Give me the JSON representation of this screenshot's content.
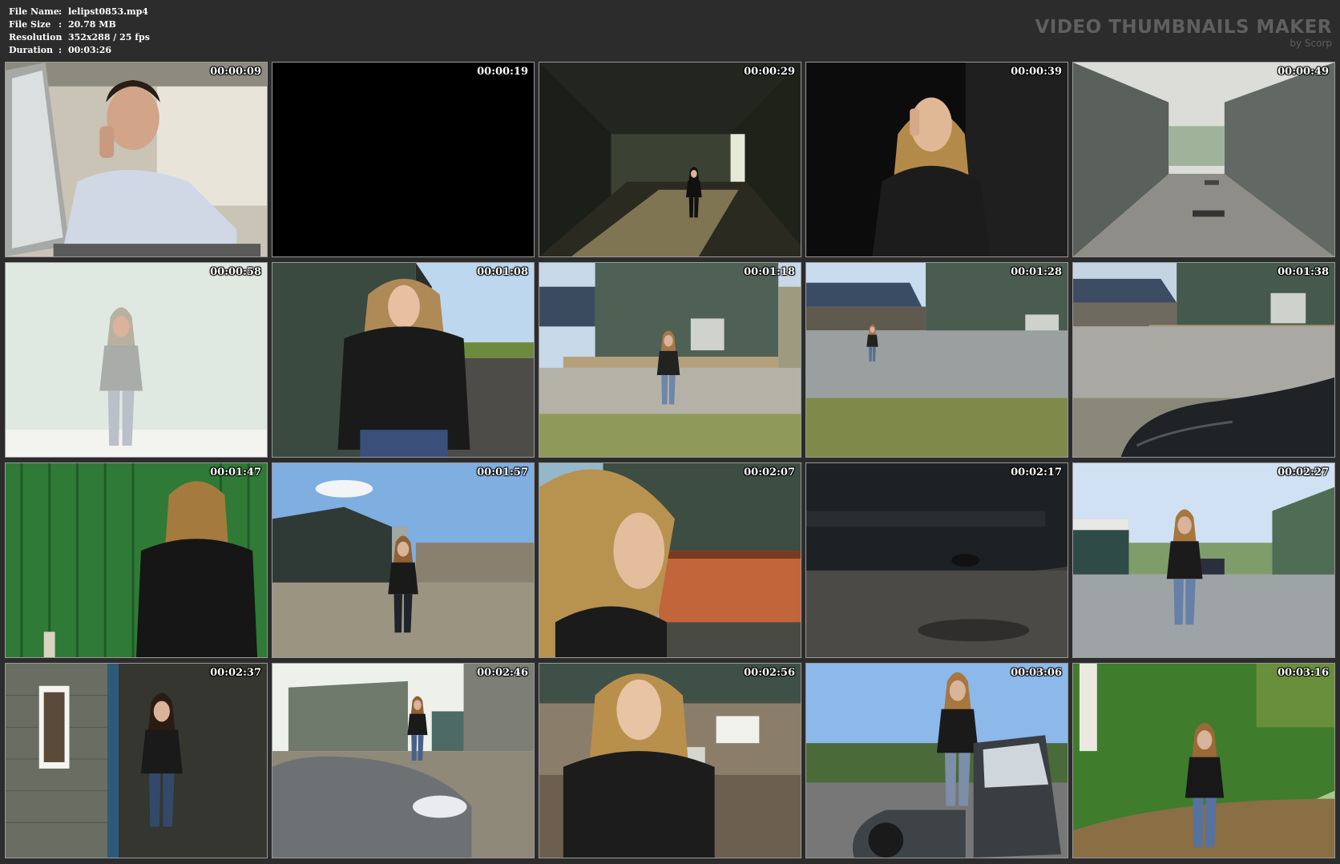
{
  "file_info": {
    "rows": [
      {
        "key": "File Name",
        "sep": ":",
        "value": "lelipst0853.mp4"
      },
      {
        "key": "File Size",
        "sep": ":",
        "value": "20.78 MB"
      },
      {
        "key": "Resolution",
        "sep": ":",
        "value": "352x288 / 25 fps"
      },
      {
        "key": "Duration",
        "sep": ":",
        "value": "00:03:26"
      }
    ]
  },
  "brand": {
    "title": "VIDEO THUMBNAILS MAKER",
    "subtitle": "by Scorp"
  },
  "thumbnails": [
    {
      "time": "00:00:09",
      "scene": "man-on-phone-office"
    },
    {
      "time": "00:00:19",
      "scene": "black-frame"
    },
    {
      "time": "00:00:29",
      "scene": "warehouse-interior"
    },
    {
      "time": "00:00:39",
      "scene": "woman-on-phone-dark"
    },
    {
      "time": "00:00:49",
      "scene": "alley-between-sheds"
    },
    {
      "time": "00:00:58",
      "scene": "overexposed-woman-walking"
    },
    {
      "time": "00:01:08",
      "scene": "woman-by-green-shed"
    },
    {
      "time": "00:01:18",
      "scene": "woman-walking-yard"
    },
    {
      "time": "00:01:28",
      "scene": "woman-walking-yard-far"
    },
    {
      "time": "00:01:38",
      "scene": "yard-with-car-bonnet"
    },
    {
      "time": "00:01:47",
      "scene": "woman-against-green-wall"
    },
    {
      "time": "00:01:57",
      "scene": "woman-walking-sky"
    },
    {
      "time": "00:02:07",
      "scene": "woman-profile-skip"
    },
    {
      "time": "00:02:17",
      "scene": "car-rear-closeup"
    },
    {
      "time": "00:02:27",
      "scene": "woman-walking-away-truck"
    },
    {
      "time": "00:02:37",
      "scene": "woman-by-brick-wall"
    },
    {
      "time": "00:02:46",
      "scene": "car-in-sunlight"
    },
    {
      "time": "00:02:56",
      "scene": "woman-closeup-building"
    },
    {
      "time": "00:03:06",
      "scene": "woman-opening-car-door"
    },
    {
      "time": "00:03:16",
      "scene": "woman-on-hill"
    }
  ]
}
